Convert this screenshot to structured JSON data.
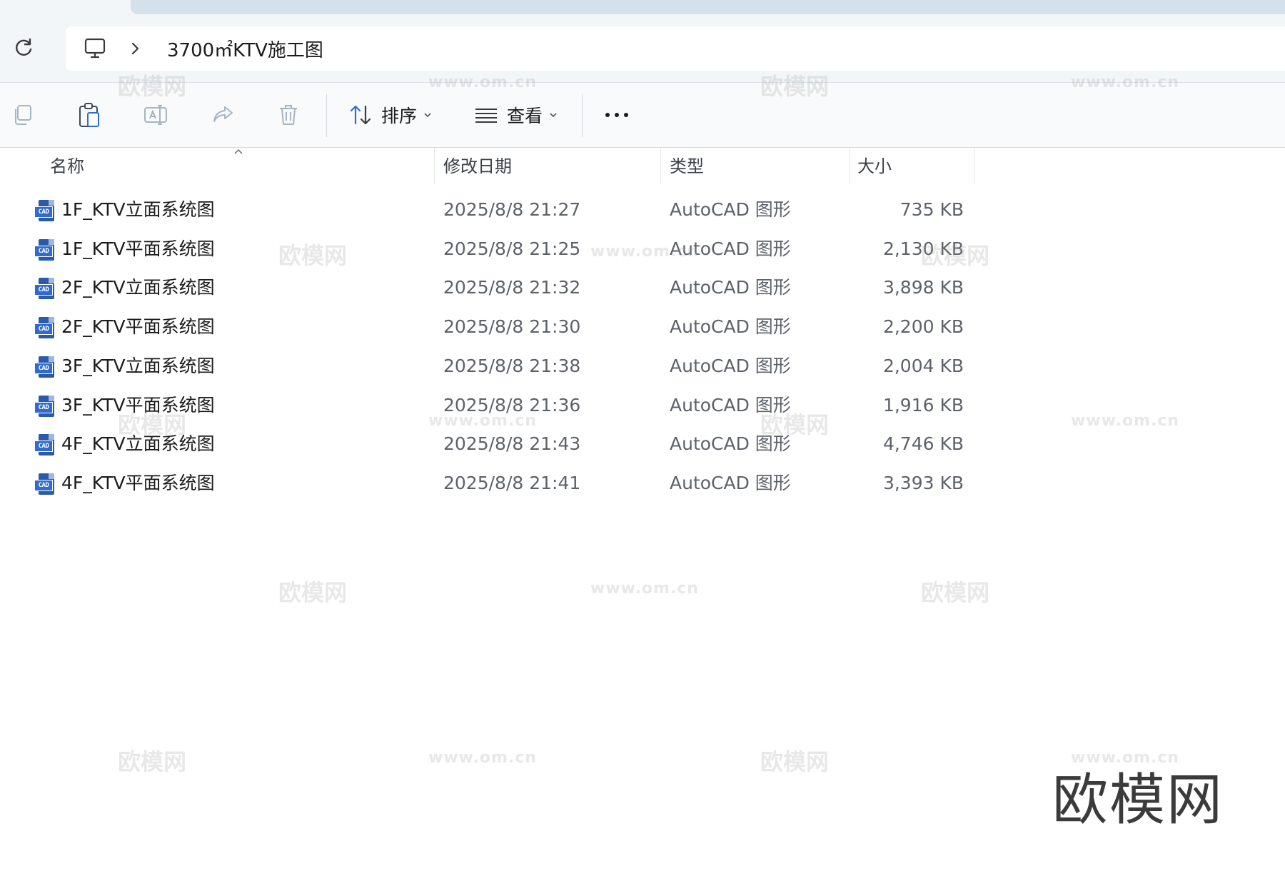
{
  "address_bar": {
    "breadcrumb": "3700㎡KTV施工图"
  },
  "toolbar": {
    "sort_label": "排序",
    "view_label": "查看"
  },
  "columns": {
    "name": "名称",
    "date": "修改日期",
    "type": "类型",
    "size": "大小"
  },
  "files": [
    {
      "name": "1F_KTV立面系统图",
      "date": "2025/8/8 21:27",
      "type": "AutoCAD 图形",
      "size": "735 KB"
    },
    {
      "name": "1F_KTV平面系统图",
      "date": "2025/8/8 21:25",
      "type": "AutoCAD 图形",
      "size": "2,130 KB"
    },
    {
      "name": "2F_KTV立面系统图",
      "date": "2025/8/8 21:32",
      "type": "AutoCAD 图形",
      "size": "3,898 KB"
    },
    {
      "name": "2F_KTV平面系统图",
      "date": "2025/8/8 21:30",
      "type": "AutoCAD 图形",
      "size": "2,200 KB"
    },
    {
      "name": "3F_KTV立面系统图",
      "date": "2025/8/8 21:38",
      "type": "AutoCAD 图形",
      "size": "2,004 KB"
    },
    {
      "name": "3F_KTV平面系统图",
      "date": "2025/8/8 21:36",
      "type": "AutoCAD 图形",
      "size": "1,916 KB"
    },
    {
      "name": "4F_KTV立面系统图",
      "date": "2025/8/8 21:43",
      "type": "AutoCAD 图形",
      "size": "4,746 KB"
    },
    {
      "name": "4F_KTV平面系统图",
      "date": "2025/8/8 21:41",
      "type": "AutoCAD 图形",
      "size": "3,393 KB"
    }
  ],
  "file_icon": {
    "name": "cad-file-icon",
    "badge": "CAD"
  },
  "watermark": {
    "brand": "欧模网",
    "url": "www.om.cn",
    "logo": "欧模网"
  },
  "icons": [
    "refresh-icon",
    "computer-icon",
    "chevron-right-icon",
    "copy-icon",
    "paste-icon",
    "rename-icon",
    "share-icon",
    "delete-icon",
    "sort-icon",
    "view-list-icon",
    "more-icon",
    "sort-up-arrow-icon"
  ]
}
